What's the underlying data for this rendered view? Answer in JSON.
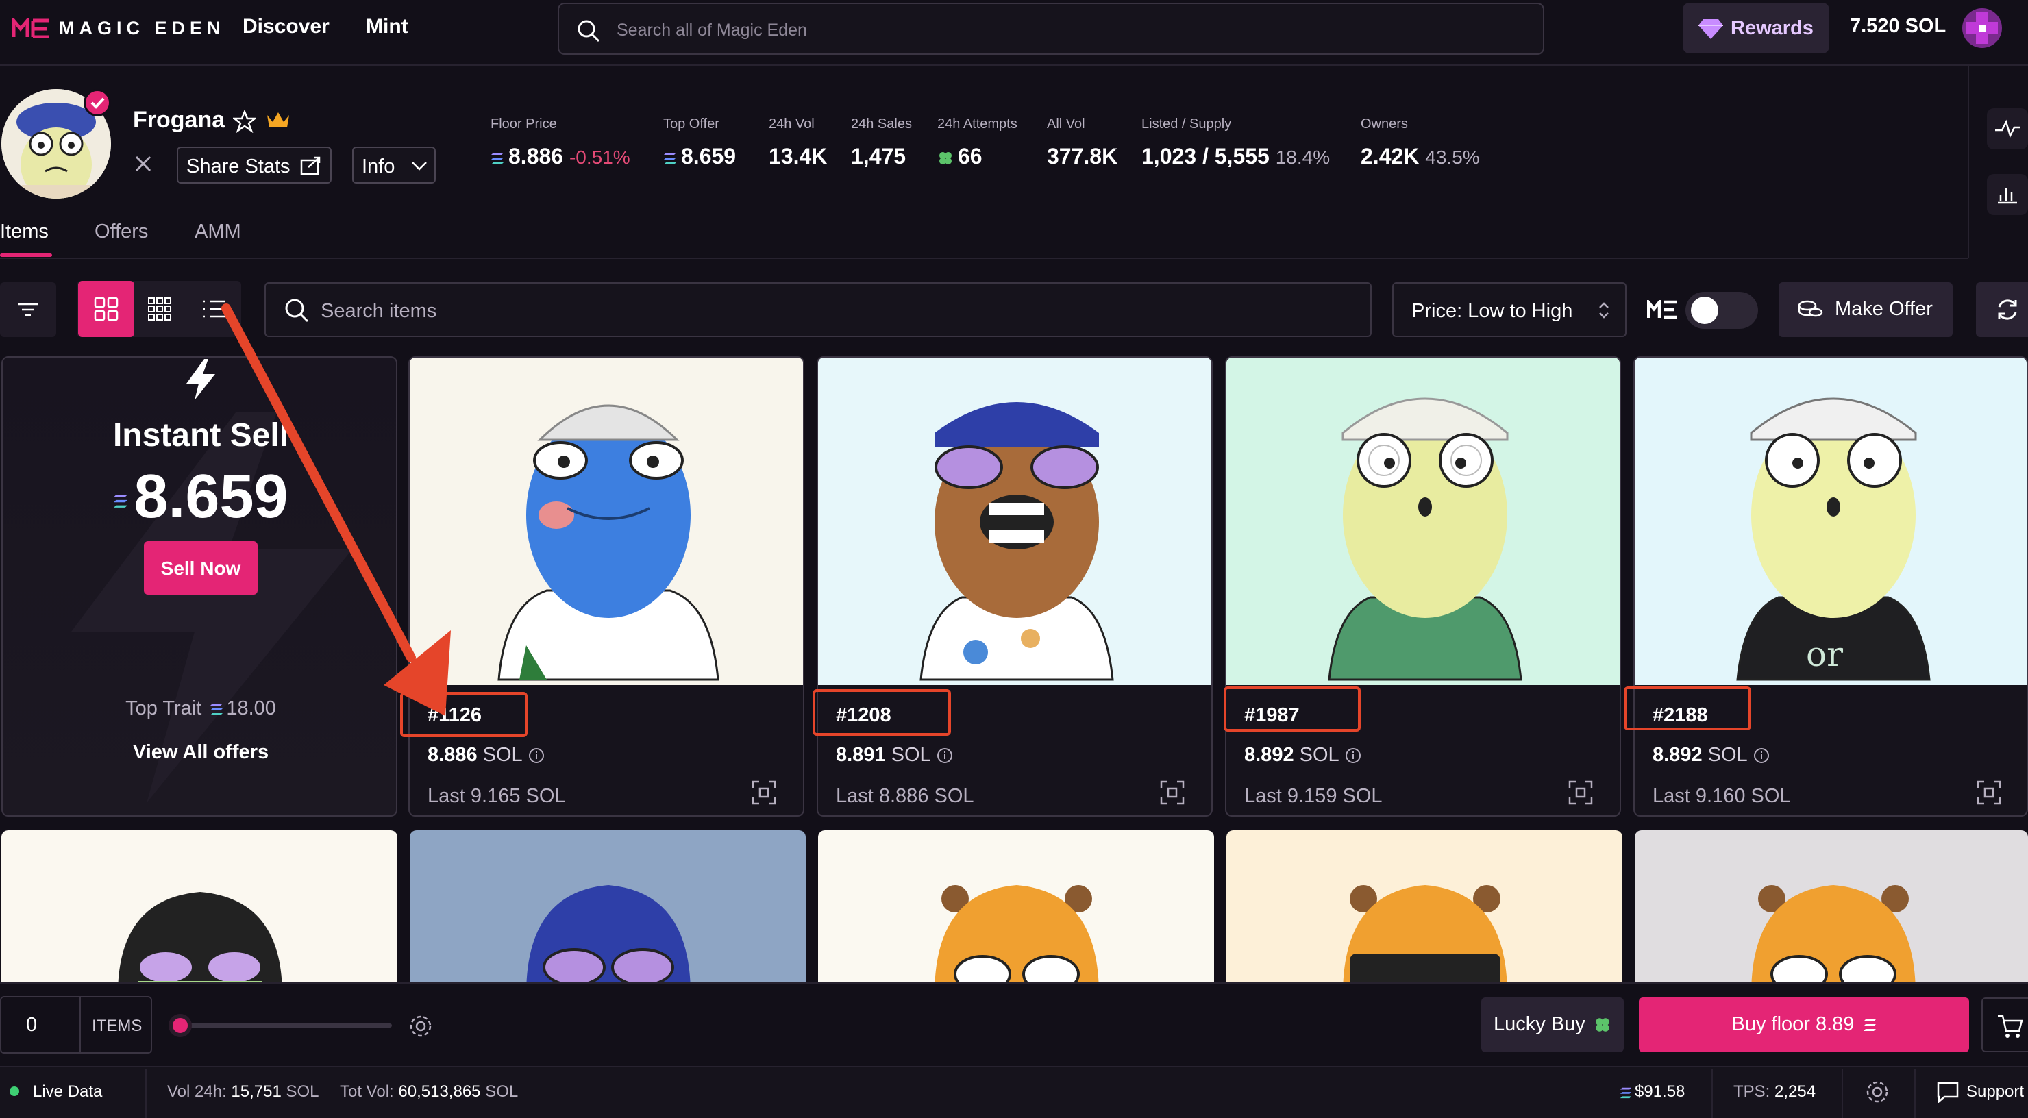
{
  "brand": {
    "name": "MAGIC EDEN"
  },
  "nav": {
    "discover": "Discover",
    "mint": "Mint"
  },
  "search": {
    "placeholder": "Search all of Magic Eden"
  },
  "account": {
    "rewards": "Rewards",
    "balance": "7.520 SOL"
  },
  "collection": {
    "name": "Frogana",
    "share_stats": "Share Stats",
    "info": "Info",
    "stats": [
      {
        "label": "Floor Price",
        "value": "8.886",
        "sub": "-0.51%"
      },
      {
        "label": "Top Offer",
        "value": "8.659"
      },
      {
        "label": "24h Vol",
        "value": "13.4K"
      },
      {
        "label": "24h Sales",
        "value": "1,475"
      },
      {
        "label": "24h Attempts",
        "value": "66"
      },
      {
        "label": "All Vol",
        "value": "377.8K"
      },
      {
        "label": "Listed / Supply",
        "value": "1,023 / 5,555",
        "sub": "18.4%"
      },
      {
        "label": "Owners",
        "value": "2.42K",
        "sub": "43.5%"
      }
    ]
  },
  "tabs": [
    {
      "label": "Items"
    },
    {
      "label": "Offers"
    },
    {
      "label": "AMM"
    }
  ],
  "toolbar": {
    "search_placeholder": "Search items",
    "sort": "Price: Low to High",
    "make_offer": "Make Offer"
  },
  "instant_sell": {
    "title": "Instant Sell",
    "price": "8.659",
    "button": "Sell Now",
    "top_trait_label": "Top Trait",
    "top_trait_value": "18.00",
    "view_all": "View All offers"
  },
  "items": [
    {
      "name": "#1126",
      "price": "8.886",
      "unit": "SOL",
      "last": "Last 9.165 SOL"
    },
    {
      "name": "#1208",
      "price": "8.891",
      "unit": "SOL",
      "last": "Last 8.886 SOL"
    },
    {
      "name": "#1987",
      "price": "8.892",
      "unit": "SOL",
      "last": "Last 9.159 SOL"
    },
    {
      "name": "#2188",
      "price": "8.892",
      "unit": "SOL",
      "last": "Last 9.160 SOL"
    }
  ],
  "bottom": {
    "count": "0",
    "items_label": "ITEMS",
    "lucky_buy": "Lucky Buy",
    "buy_floor": "Buy floor 8.89"
  },
  "status": {
    "live": "Live Data",
    "vol_label": "Vol 24h:",
    "vol_value": "15,751",
    "vol_unit": "SOL",
    "tot_label": "Tot Vol:",
    "tot_value": "60,513,865",
    "tot_unit": "SOL",
    "sol_price": "$91.58",
    "tps_label": "TPS:",
    "tps_value": "2,254",
    "support": "Support"
  },
  "colors": {
    "accent": "#e42575",
    "highlight": "#e5452a",
    "background": "#120f18"
  },
  "icons": [
    "me-logo-icon",
    "search-icon",
    "diamond-icon",
    "star-icon",
    "crown-icon",
    "x-icon",
    "share-icon",
    "chevron-down-icon",
    "solana-icon",
    "clover-icon",
    "activity-icon",
    "bar-chart-icon",
    "filter-icon",
    "grid-large-icon",
    "grid-small-icon",
    "list-icon",
    "sort-arrows-icon",
    "coins-icon",
    "refresh-icon",
    "lightning-icon",
    "info-icon",
    "expand-icon",
    "settings-icon",
    "cart-icon",
    "chat-icon",
    "arrow-annotation"
  ]
}
